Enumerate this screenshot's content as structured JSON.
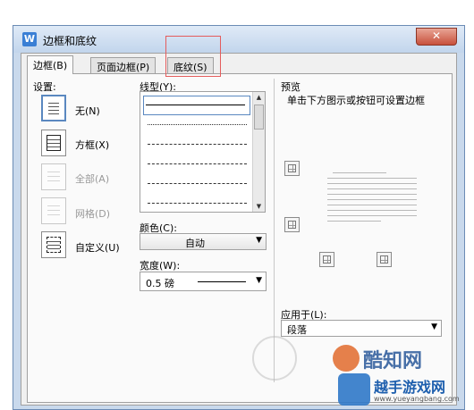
{
  "window": {
    "title": "边框和底纹",
    "app_icon": "W",
    "close_glyph": "✕"
  },
  "tabs": [
    {
      "label": "边框(B)",
      "active": true
    },
    {
      "label": "页面边框(P)",
      "active": false
    },
    {
      "label": "底纹(S)",
      "active": false
    }
  ],
  "settings": {
    "heading": "设置:",
    "items": [
      {
        "label": "无(N)",
        "icon": "none-border-icon",
        "enabled": true
      },
      {
        "label": "方框(X)",
        "icon": "box-border-icon",
        "enabled": true
      },
      {
        "label": "全部(A)",
        "icon": "all-border-icon",
        "enabled": false
      },
      {
        "label": "网格(D)",
        "icon": "grid-border-icon",
        "enabled": false
      },
      {
        "label": "自定义(U)",
        "icon": "custom-border-icon",
        "enabled": true
      }
    ]
  },
  "line_style": {
    "label": "线型(Y):"
  },
  "color": {
    "label": "颜色(C):",
    "value": "自动"
  },
  "width": {
    "label": "宽度(W):",
    "value": "0.5 磅"
  },
  "preview": {
    "heading": "预览",
    "hint": "单击下方图示或按钮可设置边框"
  },
  "apply_to": {
    "label": "应用于(L):",
    "value": "段落"
  },
  "watermark": {
    "brand_text": "酷知网",
    "site_text": "越手游戏网",
    "url": "www.yueyangbang.com"
  },
  "colors": {
    "accent": "#3a7fd5",
    "highlight": "#e45c5c"
  }
}
